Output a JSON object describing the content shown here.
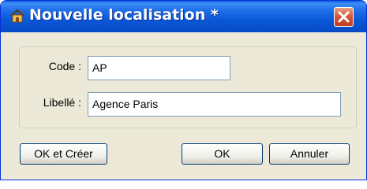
{
  "window": {
    "title": "Nouvelle localisation *",
    "icon": "house-location-icon",
    "close_icon": "close-icon"
  },
  "form": {
    "code_label": "Code :",
    "code_value": "AP",
    "libelle_label": "Libellé :",
    "libelle_value": "Agence Paris"
  },
  "buttons": {
    "ok_create": "OK et Créer",
    "ok": "OK",
    "cancel": "Annuler"
  },
  "colors": {
    "titlebar": "#0a58d8",
    "close": "#d4583a",
    "face": "#ece9d8",
    "input_border": "#7f9db9"
  }
}
